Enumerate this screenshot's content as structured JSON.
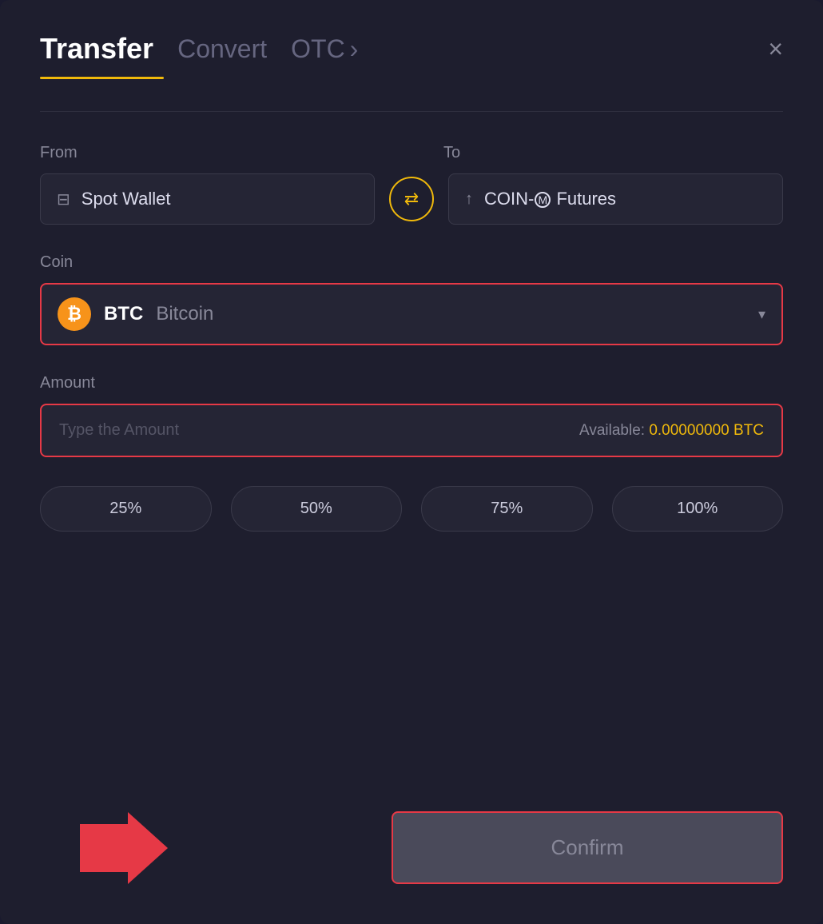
{
  "header": {
    "tab_transfer": "Transfer",
    "tab_convert": "Convert",
    "tab_otc": "OTC",
    "tab_otc_chevron": "›",
    "close_label": "×"
  },
  "from_to": {
    "from_label": "From",
    "to_label": "To",
    "from_wallet": "Spot Wallet",
    "to_wallet": "COIN-M Futures",
    "swap_icon": "⇄"
  },
  "coin": {
    "label": "Coin",
    "ticker": "BTC",
    "name": "Bitcoin",
    "chevron": "▾"
  },
  "amount": {
    "label": "Amount",
    "placeholder": "Type the Amount",
    "available_label": "Available:",
    "available_value": "0.00000000",
    "available_currency": "BTC"
  },
  "percentages": [
    {
      "label": "25%"
    },
    {
      "label": "50%"
    },
    {
      "label": "75%"
    },
    {
      "label": "100%"
    }
  ],
  "confirm": {
    "label": "Confirm"
  },
  "colors": {
    "accent_yellow": "#f0b90b",
    "red_highlight": "#e63946",
    "bg_dark": "#1e1e2e",
    "bg_input": "#252535"
  }
}
